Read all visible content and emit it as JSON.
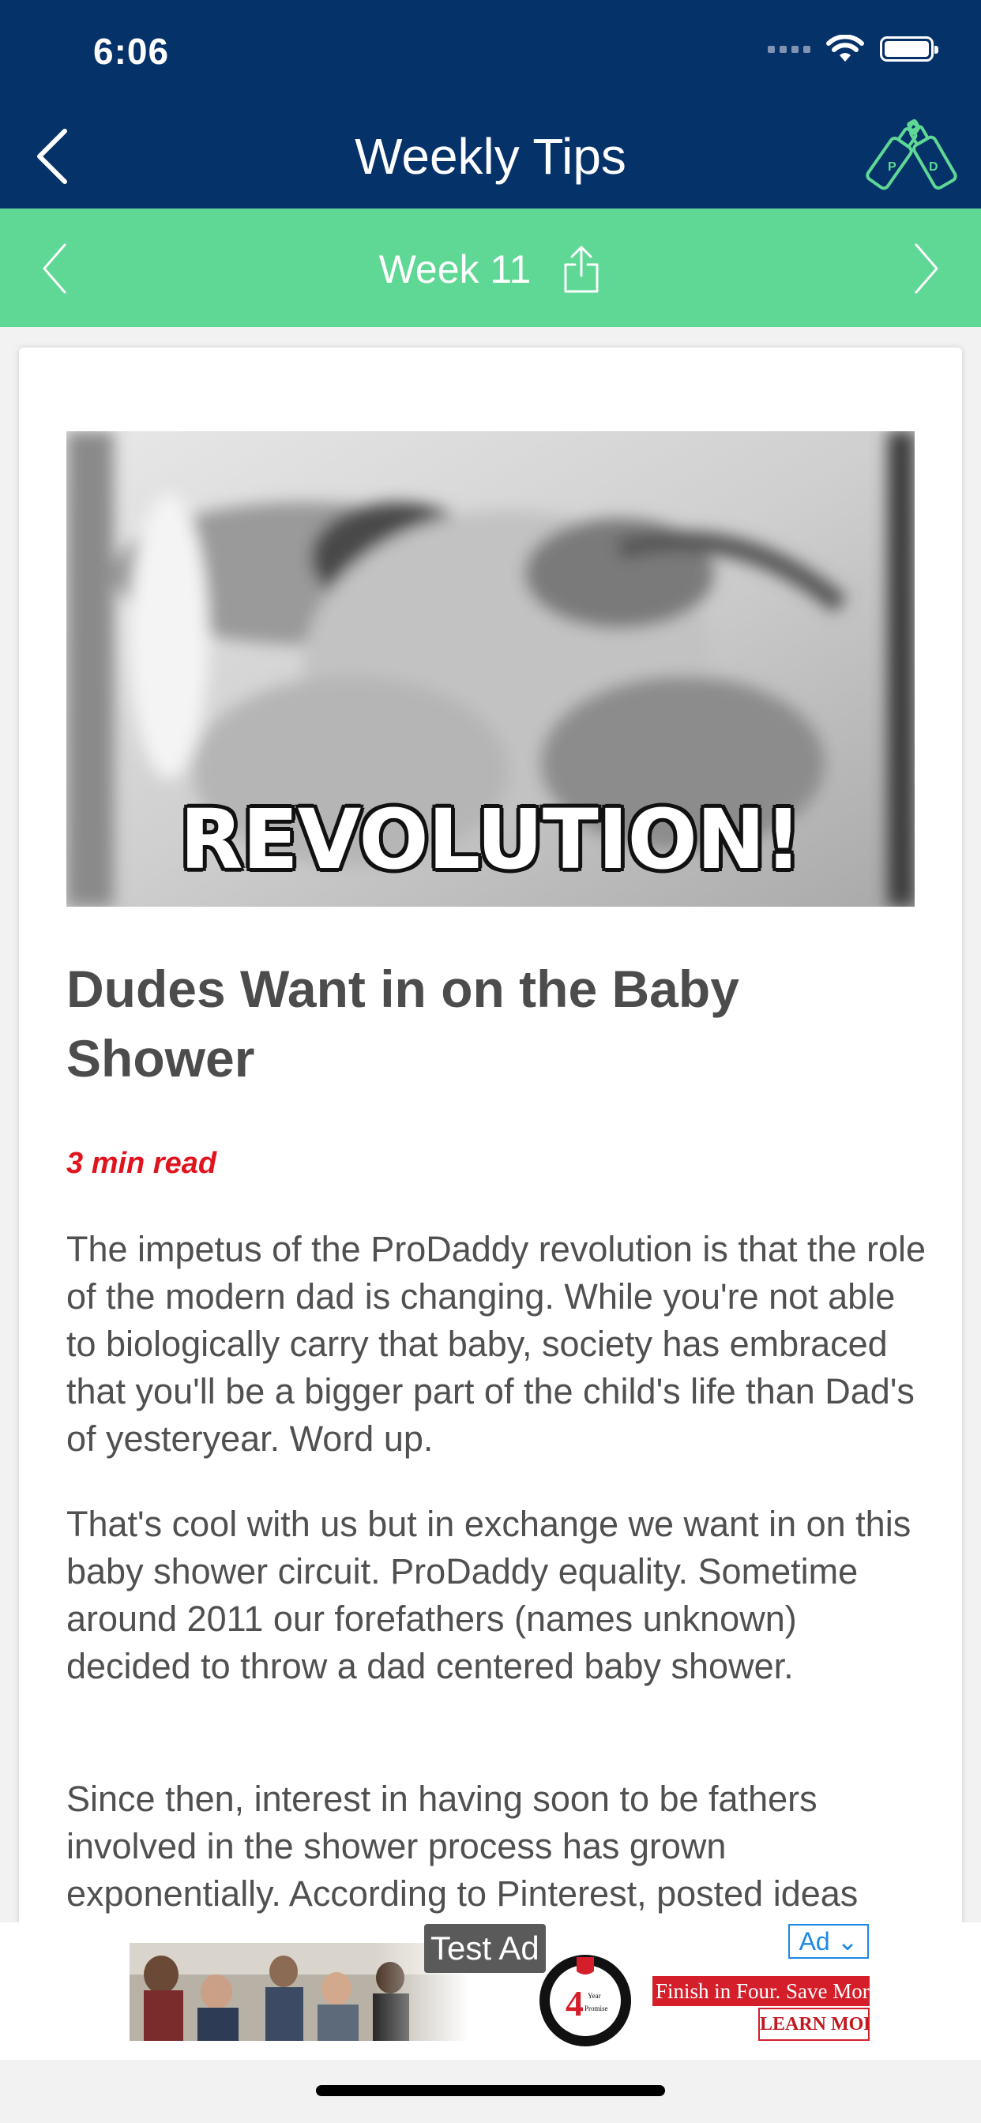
{
  "status_bar": {
    "time": "6:06"
  },
  "nav": {
    "title": "Weekly Tips",
    "back_icon": "chevron-left-icon",
    "logo_icon": "bottles-logo-icon"
  },
  "week_selector": {
    "label": "Week 11",
    "prev_icon": "chevron-left-icon",
    "next_icon": "chevron-right-icon",
    "share_icon": "share-icon"
  },
  "article": {
    "hero_caption": "REVOLUTION!",
    "title": "Dudes Want in on the Baby Shower",
    "read_time": "3 min read",
    "paragraphs": [
      "The impetus of the ProDaddy revolution is that the role of the modern dad is changing. While you're not able to biologically carry that baby, society has embraced that you'll be a bigger part of the child's life than Dad's of yesteryear. Word up.",
      "That's cool with us but in exchange we want in on this baby shower circuit. ProDaddy equality. Sometime around 2011 our forefathers (names unknown) decided to throw a dad centered baby shower.",
      "Since then, interest in having soon to be fathers involved in the shower process has grown exponentially. According to Pinterest, posted ideas"
    ]
  },
  "ad": {
    "test_label": "Test Ad",
    "badge": "Ad ⌄",
    "cta": "Finish in Four. Save Mor",
    "learn_more": "LEARN MOR",
    "seal_text": "4 Year Promise"
  },
  "colors": {
    "nav": "#06326a",
    "week_bar": "#5ed894",
    "accent_red": "#e0141e",
    "ad_red": "#d41f2b",
    "ad_blue": "#1e88e5"
  }
}
